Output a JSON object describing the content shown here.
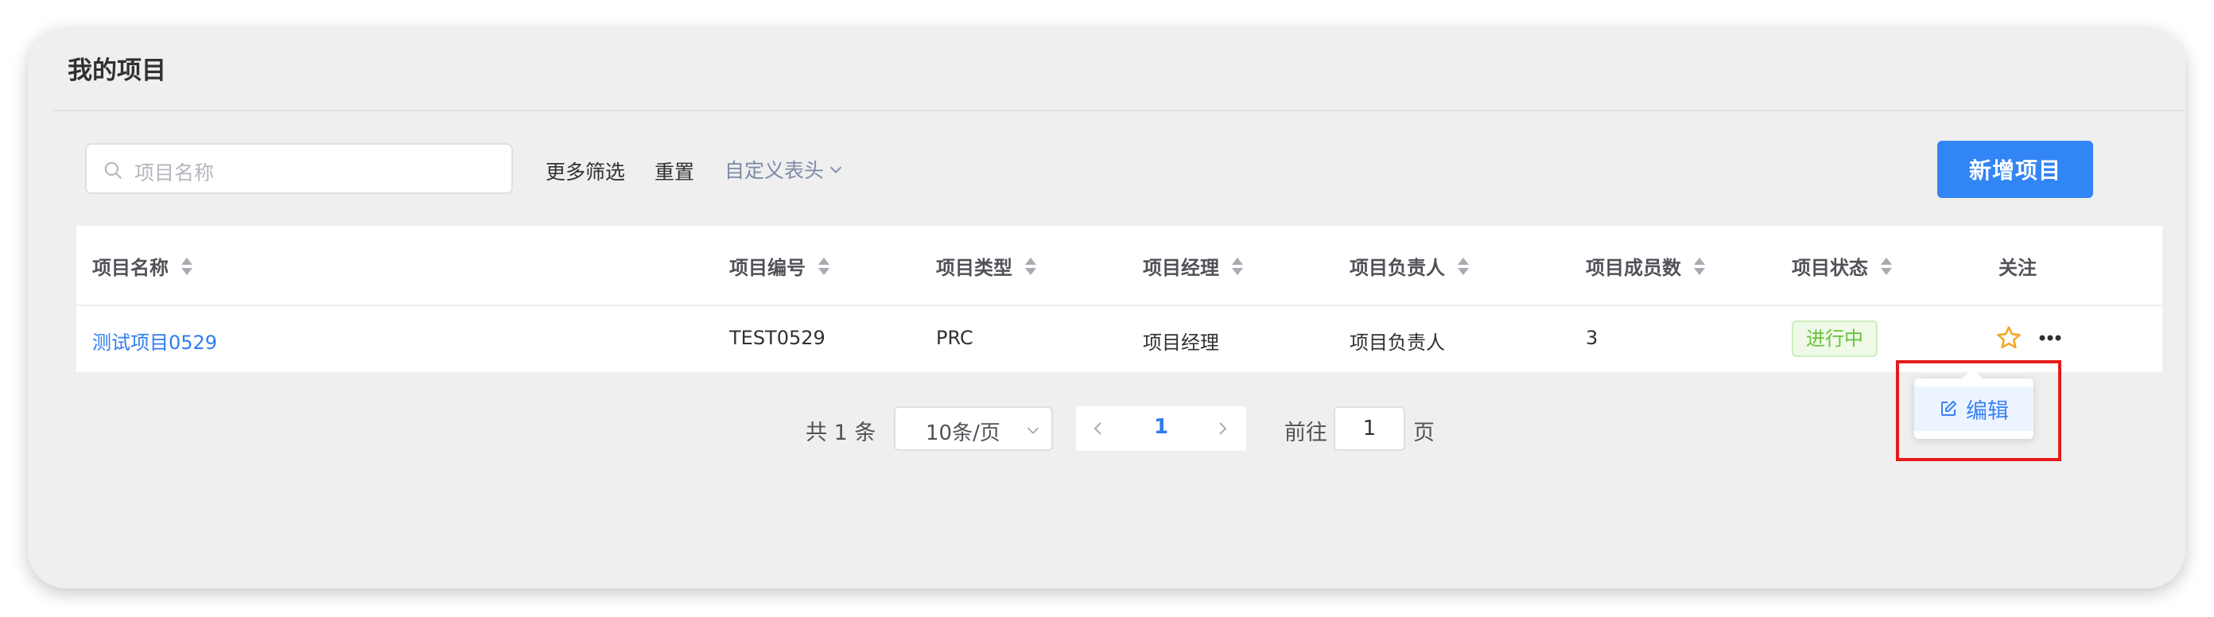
{
  "page": {
    "title": "我的项目"
  },
  "toolbar": {
    "search_placeholder": "项目名称",
    "more_filters": "更多筛选",
    "reset": "重置",
    "custom_header": "自定义表头",
    "new_project": "新增项目"
  },
  "table": {
    "columns": [
      "项目名称",
      "项目编号",
      "项目类型",
      "项目经理",
      "项目负责人",
      "项目成员数",
      "项目状态",
      "关注"
    ],
    "rows": [
      {
        "name": "测试项目0529",
        "code": "TEST0529",
        "type": "PRC",
        "manager": "项目经理",
        "owner": "项目负责人",
        "members": "3",
        "status": "进行中"
      }
    ]
  },
  "pagination": {
    "total": "共 1 条",
    "page_size": "10条/页",
    "current_page": "1",
    "goto_label": "前往",
    "goto_value": "1",
    "goto_unit": "页"
  },
  "dropdown": {
    "edit": "编辑"
  },
  "colors": {
    "primary": "#3285f5",
    "link": "#2f7cf0",
    "status_success": "#67c23a",
    "highlight": "#e41b1b",
    "star": "#f5a623"
  },
  "icons": [
    "search-icon",
    "chevron-down-icon",
    "sort-icon",
    "star-icon",
    "more-icon",
    "chevron-left-icon",
    "chevron-right-icon",
    "edit-icon"
  ]
}
